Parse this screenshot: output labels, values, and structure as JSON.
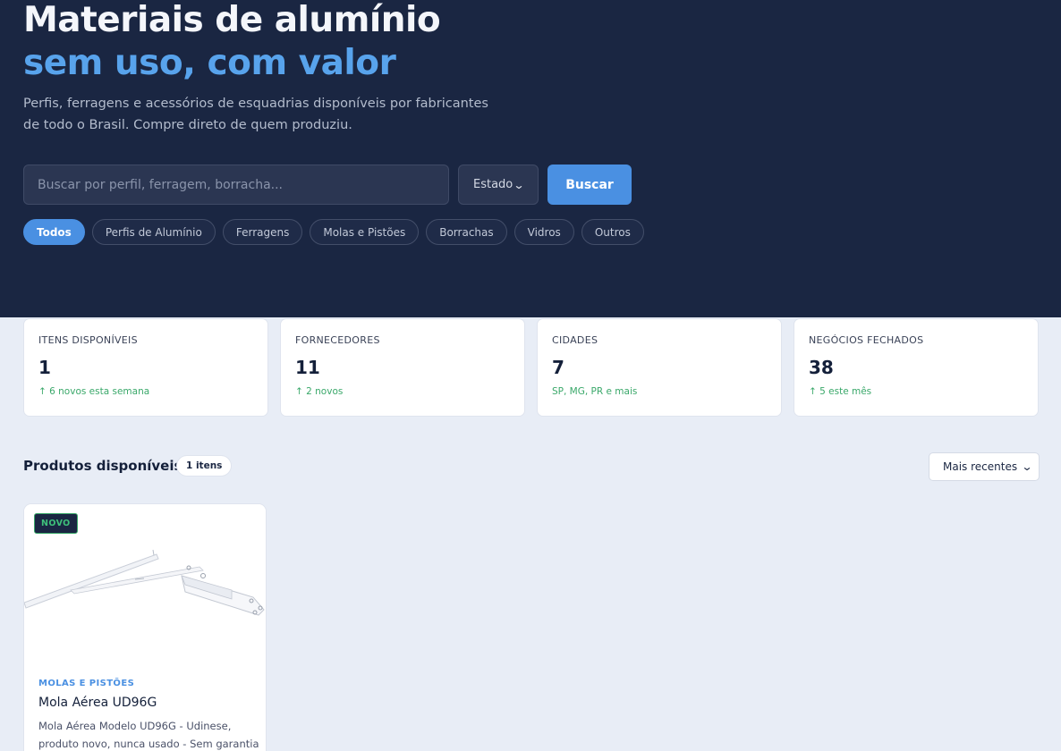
{
  "hero": {
    "title": "Materiais de alumínio",
    "title_accent": "sem uso, com valor",
    "subtitle": "Perfis, ferragens e acessórios de esquadrias disponíveis por fabricantes de todo o Brasil. Compre direto de quem produziu."
  },
  "search": {
    "placeholder": "Buscar por perfil, ferragem, borracha...",
    "state_label": "Estado",
    "button_label": "Buscar"
  },
  "categories": [
    "Todos",
    "Perfis de Alumínio",
    "Ferragens",
    "Molas e Pistões",
    "Borrachas",
    "Vidros",
    "Outros"
  ],
  "stats": [
    {
      "label": "ITENS DISPONÍVEIS",
      "value": "1",
      "note": "↑ 6 novos esta semana"
    },
    {
      "label": "FORNECEDORES",
      "value": "11",
      "note": "↑ 2 novos"
    },
    {
      "label": "CIDADES",
      "value": "7",
      "note": "SP, MG, PR e mais"
    },
    {
      "label": "NEGÓCIOS FECHADOS",
      "value": "38",
      "note": "↑ 5 este mês"
    }
  ],
  "products_section": {
    "title": "Produtos disponíveis",
    "count": "1 itens",
    "sort_label": "Mais recentes"
  },
  "product": {
    "badge": "NOVO",
    "category": "MOLAS E PISTÕES",
    "title": "Mola Aérea UD96G",
    "description": "Mola Aérea Modelo UD96G - Udinese, produto novo, nunca usado - Sem garantia"
  },
  "colors": {
    "hero_bg": "#1a2642",
    "accent": "#4a90e2",
    "accent_text": "#58a3ec",
    "positive": "#3aa86a",
    "page_bg": "#e8edf6"
  }
}
